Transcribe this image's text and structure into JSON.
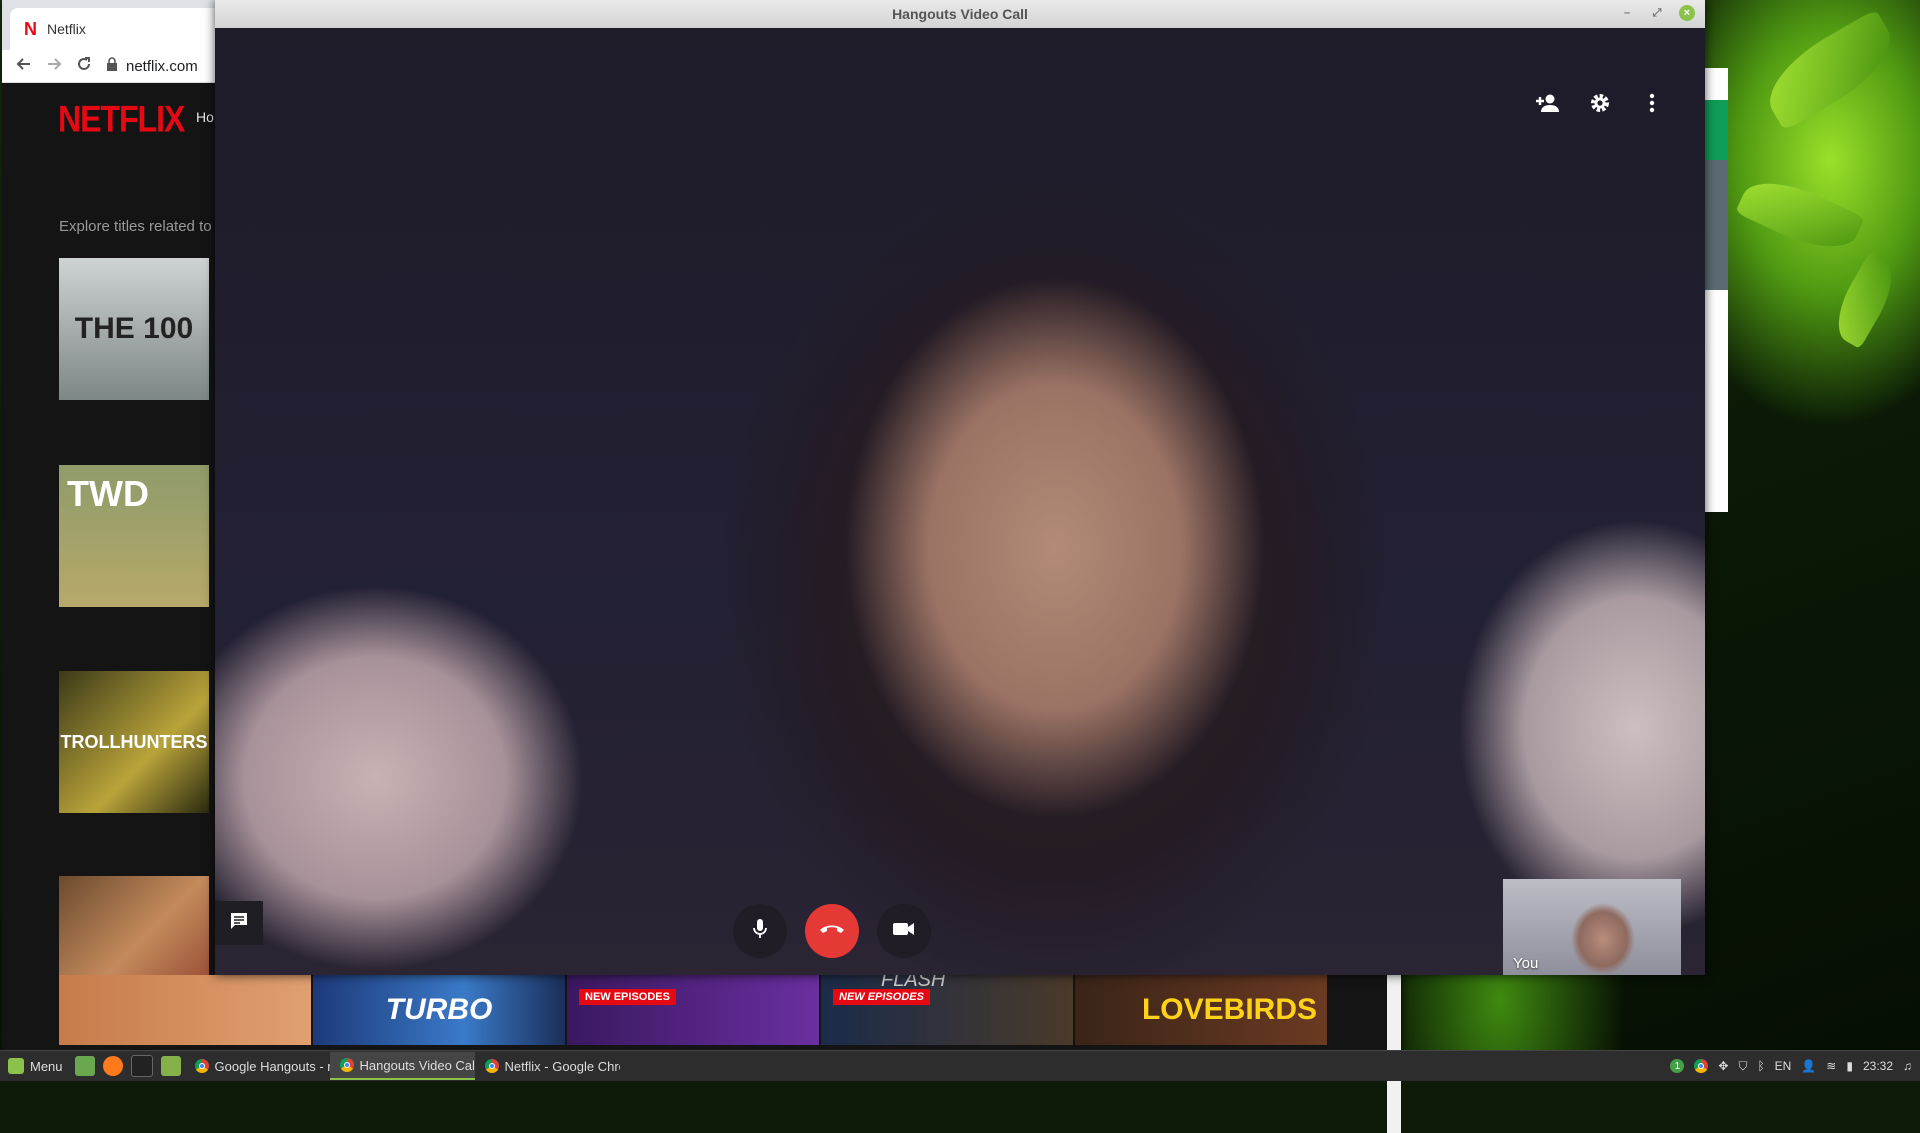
{
  "chrome": {
    "tab_title": "Netflix",
    "url": "netflix.com",
    "netflix_logo": "NETFLIX",
    "nav_partial": "Ho",
    "explore_text": "Explore titles related to",
    "thumbs": [
      {
        "label": "THE 100"
      },
      {
        "label": "TWD"
      },
      {
        "label": "TROLLHUNTERS"
      },
      {
        "label": ""
      }
    ],
    "bottom_tiles": [
      {
        "label": "",
        "badge": ""
      },
      {
        "label": "TURBO",
        "badge": ""
      },
      {
        "label": "",
        "badge": "NEW EPISODES"
      },
      {
        "label": "FLASH",
        "badge": "NEW EPISODES"
      },
      {
        "label": "LOVEBIRDS",
        "badge": ""
      }
    ]
  },
  "hangouts": {
    "title": "Hangouts Video Call",
    "self_label": "You",
    "icons": {
      "add_person": "add-person-icon",
      "settings": "gear-icon",
      "more": "more-vert-icon",
      "mic": "microphone-icon",
      "end_call": "end-call-icon",
      "camera": "video-camera-icon",
      "chat": "chat-icon"
    },
    "colors": {
      "end_call": "#e53935",
      "close_button": "#8bc34a"
    }
  },
  "taskbar": {
    "menu_label": "Menu",
    "tasks": [
      {
        "label": "Google Hangouts - n..."
      },
      {
        "label": "Hangouts Video Call"
      },
      {
        "label": "Netflix - Google Chro..."
      }
    ],
    "tray_badge": "1",
    "keyboard_layout": "EN",
    "time": "23:32"
  }
}
